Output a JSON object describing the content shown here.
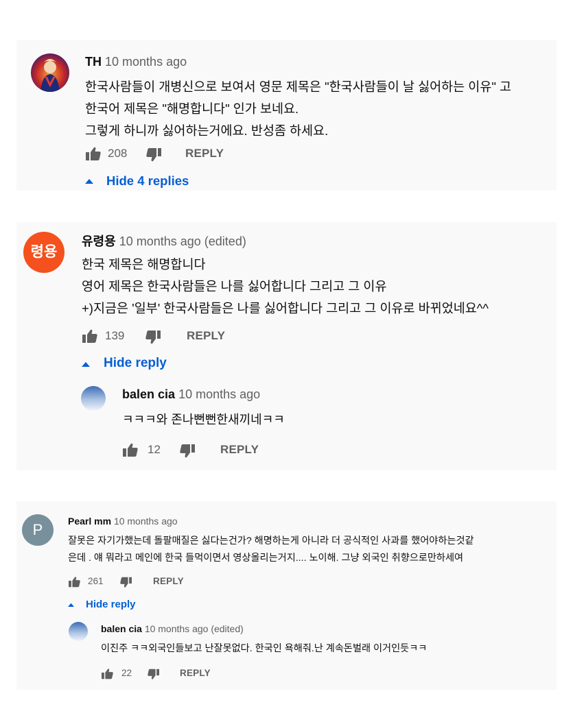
{
  "comments": [
    {
      "author": "TH",
      "time": "10 months ago",
      "lines": [
        "한국사람들이 개병신으로 보여서 영문 제목은 \"한국사람들이 날 싫어하는 이유\" 고",
        "한국어 제목은 \"해명합니다\" 인가 보네요.",
        "그렇게 하니까 싫어하는거에요. 반성좀 하세요."
      ],
      "likes": "208",
      "reply_label": "REPLY",
      "toggle_label": "Hide 4 replies"
    },
    {
      "author": "유령용",
      "avatar_text": "령용",
      "avatar_color": "#f4511e",
      "time": "10 months ago (edited)",
      "lines": [
        "한국 제목은 해명합니다",
        "영어 제목은 한국사람들은 나를 싫어합니다 그리고 그 이유",
        "+)지금은 '일부' 한국사람들은 나를 싫어합니다 그리고 그 이유로 바뀌었네요^^"
      ],
      "likes": "139",
      "reply_label": "REPLY",
      "toggle_label": "Hide reply",
      "reply": {
        "author": "balen cia",
        "time": "10 months ago",
        "text": "ㅋㅋㅋ와 존나뻔뻔한새끼네ㅋㅋ",
        "likes": "12",
        "reply_label": "REPLY"
      }
    },
    {
      "author": "Pearl mm",
      "avatar_text": "P",
      "avatar_color": "#78909c",
      "time": "10 months ago",
      "lines": [
        "잘못은 자기가했는데 돌팔매질은 싫다는건가? 해명하는게 아니라 더 공식적인 사과를 했어야하는것같",
        "은데 . 얘 뭐라고 메인에 한국 들먹이면서 영상올리는거지.... 노이해. 그냥 외국인 취향으로만하세여"
      ],
      "likes": "261",
      "reply_label": "REPLY",
      "toggle_label": "Hide reply",
      "reply": {
        "author": "balen cia",
        "time": "10 months ago (edited)",
        "text": "이진주 ㅋㅋ외국인들보고 난잘못없다. 한국인 욕해줘.난 계속돈벌래 이거인듯ㅋㅋ",
        "likes": "22",
        "reply_label": "REPLY"
      }
    }
  ],
  "icons": {
    "like": "thumb-up-icon",
    "dislike": "thumb-down-icon",
    "toggle": "caret-up-icon"
  },
  "colors": {
    "link_blue": "#065fd4",
    "meta_gray": "#606060",
    "card_bg": "#f9f9f9"
  }
}
